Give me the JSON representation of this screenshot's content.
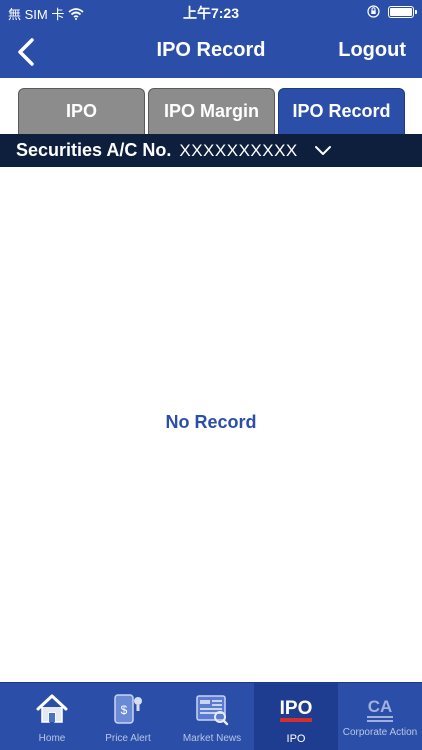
{
  "status_bar": {
    "carrier": "無 SIM 卡",
    "time": "上午7:23"
  },
  "nav": {
    "title": "IPO Record",
    "logout_label": "Logout"
  },
  "tabs": [
    {
      "label": "IPO",
      "active": false
    },
    {
      "label": "IPO Margin",
      "active": false
    },
    {
      "label": "IPO Record",
      "active": true
    }
  ],
  "account": {
    "label": "Securities A/C No.",
    "value": "XXXXXXXXXX"
  },
  "content": {
    "empty_message": "No Record"
  },
  "tabbar": {
    "items": [
      {
        "label": "Home",
        "icon": "home-icon",
        "active": false
      },
      {
        "label": "Price Alert",
        "icon": "price-alert-icon",
        "active": false
      },
      {
        "label": "Market News",
        "icon": "market-news-icon",
        "active": false
      },
      {
        "label": "IPO",
        "icon": "ipo-icon",
        "icon_text": "IPO",
        "active": true
      },
      {
        "label": "Corporate Action",
        "icon": "corporate-action-icon",
        "icon_text": "CA",
        "active": false
      }
    ]
  },
  "colors": {
    "brand_blue": "#2b4fa8",
    "account_bar": "#0d1f3c",
    "tab_inactive": "#8c8c8c",
    "empty_text": "#2b4fa8"
  }
}
